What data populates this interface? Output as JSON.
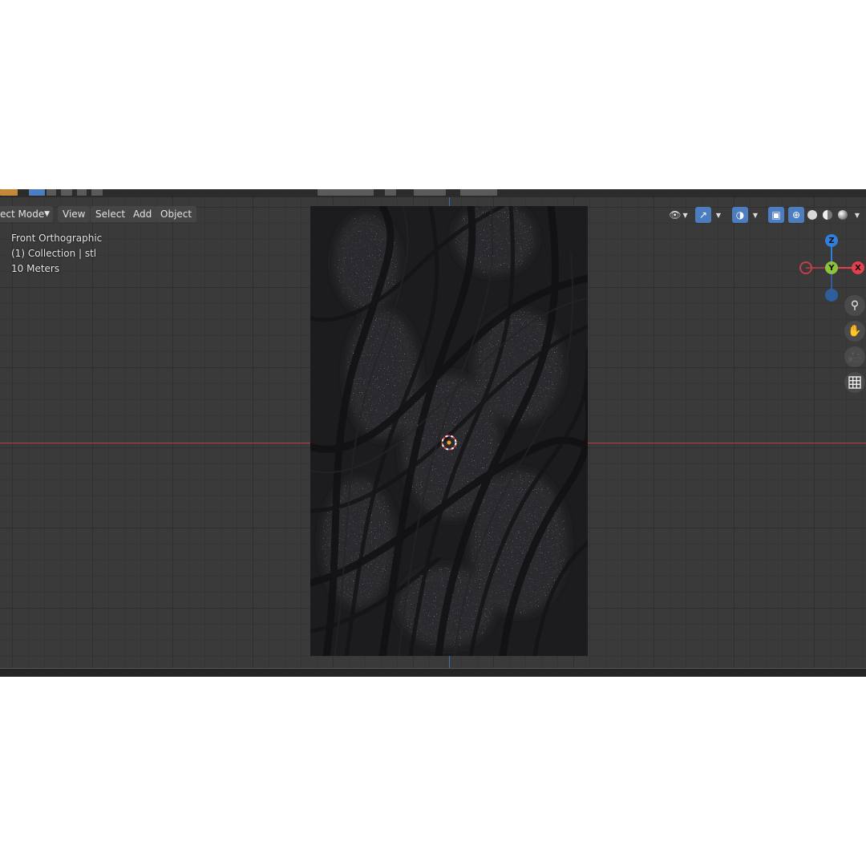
{
  "header": {
    "mode_label": "ect Mode",
    "menu": [
      "View",
      "Select",
      "Add",
      "Object"
    ]
  },
  "overlay": {
    "view_name": "Front Orthographic",
    "collection": "(1) Collection | stl",
    "scale": "10 Meters"
  },
  "gizmo": {
    "z": "Z",
    "y": "Y",
    "x": "X",
    "colors": {
      "x": "#e2404f",
      "y": "#8bc33e",
      "z": "#2f7fdb"
    }
  },
  "nav_icons": [
    "zoom-icon",
    "hand-pan-icon",
    "camera-icon",
    "grid-icon"
  ],
  "colors": {
    "accent": "#4c7dc0",
    "viewport_bg": "#3a3a3a",
    "mesh_bg": "#1b1b1d"
  }
}
